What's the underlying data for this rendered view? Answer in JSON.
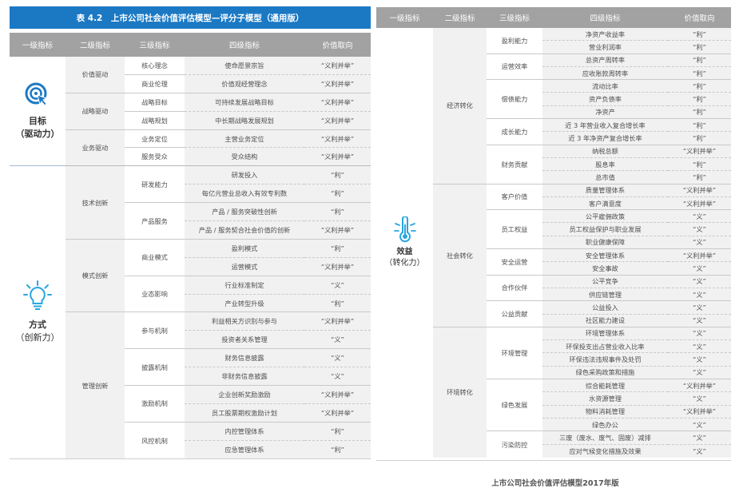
{
  "left_table": {
    "title": "表 4.2　上市公司社会价值评估模型—评分子模型（通用版）",
    "headers": [
      "一级指标",
      "二级指标",
      "三级指标",
      "四级指标",
      "价值取向"
    ],
    "groups": [
      {
        "name": "目标",
        "sub": "（驱动力）",
        "icon": "target-cursor-icon"
      },
      {
        "name": "方式",
        "sub": "（创新力）",
        "icon": "lightbulb-icon"
      }
    ],
    "level2": [
      "价值驱动",
      "战略驱动",
      "业务驱动",
      "技术创新",
      "模式创新",
      "管理创新"
    ],
    "level3": [
      "核心理念",
      "商业伦理",
      "战略目标",
      "战略规划",
      "业务定位",
      "服务受众",
      "研发能力",
      "产品服务",
      "商业模式",
      "业态影响",
      "参与机制",
      "披露机制",
      "激励机制",
      "风控机制"
    ],
    "rows": [
      {
        "d4": "使命愿景宗旨",
        "v": "“义利并举”"
      },
      {
        "d4": "价值观经营理念",
        "v": "“义利并举”"
      },
      {
        "d4": "可持续发展战略目标",
        "v": "“义利并举”"
      },
      {
        "d4": "中长期战略发展规划",
        "v": "“义利并举”"
      },
      {
        "d4": "主营业务定位",
        "v": "“义利并举”"
      },
      {
        "d4": "受众结构",
        "v": "“义利并举”"
      },
      {
        "d4": "研发投入",
        "v": "“利”"
      },
      {
        "d4": "每亿元营业总收入有效专利数",
        "v": "“利”"
      },
      {
        "d4": "产品 / 服务突破性创新",
        "v": "“利”"
      },
      {
        "d4": "产品 / 服务契合社会价值的创新",
        "v": "“义利并举”"
      },
      {
        "d4": "盈利模式",
        "v": "“利”"
      },
      {
        "d4": "运营模式",
        "v": "“义利并举”"
      },
      {
        "d4": "行业标准制定",
        "v": "“义”"
      },
      {
        "d4": "产业转型升级",
        "v": "“利”"
      },
      {
        "d4": "利益相关方识别与参与",
        "v": "“义利并举”"
      },
      {
        "d4": "投资者关系管理",
        "v": "“义”"
      },
      {
        "d4": "财务信息披露",
        "v": "“义”"
      },
      {
        "d4": "非财务信息披露",
        "v": "“义”"
      },
      {
        "d4": "企业创新奖励激励",
        "v": "“义利并举”"
      },
      {
        "d4": "员工股票期权激励计划",
        "v": "“义利并举”"
      },
      {
        "d4": "内控管理体系",
        "v": "“利”"
      },
      {
        "d4": "应急管理体系",
        "v": "“利”"
      }
    ]
  },
  "right_table": {
    "headers": [
      "一级指标",
      "二级指标",
      "三级指标",
      "四级指标",
      "价值取向"
    ],
    "group": {
      "name": "效益",
      "sub": "（转化力）",
      "icon": "thermometer-sun-icon"
    },
    "level2": [
      "经济转化",
      "社会转化",
      "环境转化"
    ],
    "level3": [
      "盈利能力",
      "运营效率",
      "偿债能力",
      "成长能力",
      "财务贡献",
      "客户价值",
      "员工权益",
      "安全运营",
      "合作伙伴",
      "公益贡献",
      "环境管理",
      "绿色发展",
      "污染防控"
    ],
    "rows": [
      {
        "d4": "净资产收益率",
        "v": "“利”"
      },
      {
        "d4": "营业利润率",
        "v": "“利”"
      },
      {
        "d4": "总资产周转率",
        "v": "“利”"
      },
      {
        "d4": "应收账款周转率",
        "v": "“利”"
      },
      {
        "d4": "流动比率",
        "v": "“利”"
      },
      {
        "d4": "资产负债率",
        "v": "“利”"
      },
      {
        "d4": "净资产",
        "v": "“利”"
      },
      {
        "d4": "近 3 年营业收入复合增长率",
        "v": "“利”"
      },
      {
        "d4": "近 3 年净资产复合增长率",
        "v": "“利”"
      },
      {
        "d4": "纳税总额",
        "v": "“义利并举”"
      },
      {
        "d4": "股息率",
        "v": "“利”"
      },
      {
        "d4": "总市值",
        "v": "“利”"
      },
      {
        "d4": "质量管理体系",
        "v": "“义利并举”"
      },
      {
        "d4": "客户满意度",
        "v": "“义利并举”"
      },
      {
        "d4": "公平雇佣政策",
        "v": "“义”"
      },
      {
        "d4": "员工权益保护与职业发展",
        "v": "“义”"
      },
      {
        "d4": "职业健康保障",
        "v": "“义”"
      },
      {
        "d4": "安全管理体系",
        "v": "“义利并举”"
      },
      {
        "d4": "安全事故",
        "v": "“义”"
      },
      {
        "d4": "公平竞争",
        "v": "“义”"
      },
      {
        "d4": "供应链管理",
        "v": "“义”"
      },
      {
        "d4": "公益投入",
        "v": "“义”"
      },
      {
        "d4": "社区能力建设",
        "v": "“义”"
      },
      {
        "d4": "环境管理体系",
        "v": "“义”"
      },
      {
        "d4": "环保投支出占营业收入比率",
        "v": "“义”"
      },
      {
        "d4": "环保违法违规事件及处罚",
        "v": "“义”"
      },
      {
        "d4": "绿色采购政策和措施",
        "v": "“义”"
      },
      {
        "d4": "综合能耗管理",
        "v": "“义利并举”"
      },
      {
        "d4": "水资源管理",
        "v": "“义”"
      },
      {
        "d4": "物料消耗管理",
        "v": "“义利并举”"
      },
      {
        "d4": "绿色办公",
        "v": "“义”"
      },
      {
        "d4": "三废（废水、废气、固废）减排",
        "v": "“义”"
      },
      {
        "d4": "应对气候变化措施及效果",
        "v": "“义”"
      }
    ]
  },
  "footer": {
    "caption": "上市公司社会价值评估模型2017年版"
  },
  "colors": {
    "title_bar": "#1b79c4",
    "header_bg": "#a2a2a2",
    "icon_blue": "#1b79c4",
    "separator": "#cfcfcf"
  }
}
